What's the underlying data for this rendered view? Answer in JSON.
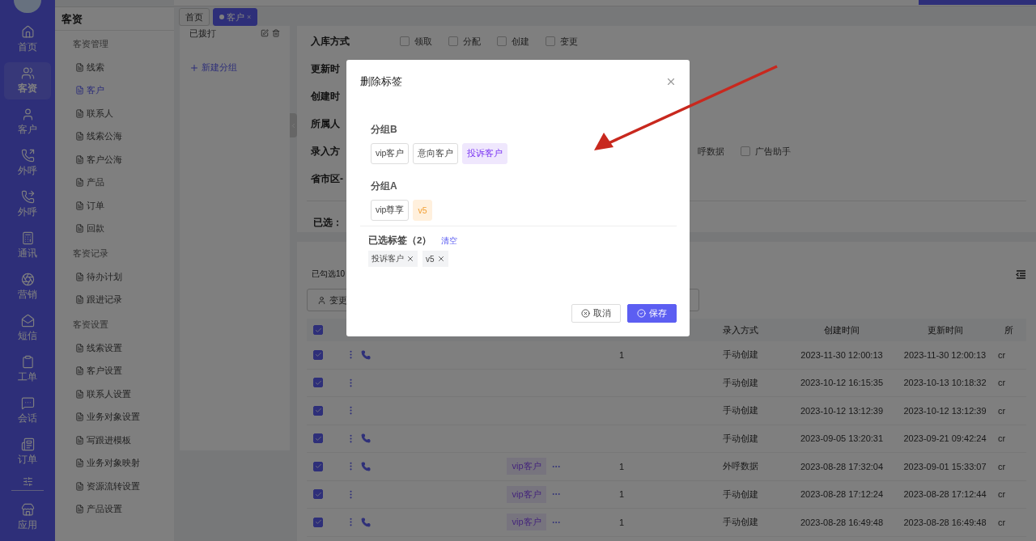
{
  "rail": {
    "items": [
      {
        "kind": "home",
        "label": "首页",
        "selected": false
      },
      {
        "kind": "users",
        "label": "客资",
        "selected": true
      },
      {
        "kind": "user",
        "label": "客户",
        "selected": false
      },
      {
        "kind": "call-out",
        "label": "外呼",
        "selected": false
      },
      {
        "kind": "call-forward",
        "label": "外呼",
        "selected": false
      },
      {
        "kind": "calculator",
        "label": "通讯",
        "selected": false
      },
      {
        "kind": "aperture",
        "label": "营销",
        "selected": false
      },
      {
        "kind": "mail",
        "label": "短信",
        "selected": false
      },
      {
        "kind": "clipboard",
        "label": "工单",
        "selected": false
      },
      {
        "kind": "chat",
        "label": "会话",
        "selected": false
      },
      {
        "kind": "list",
        "label": "订单",
        "selected": false
      },
      {
        "kind": "store",
        "label": "应用",
        "selected": false
      }
    ]
  },
  "sidebar": {
    "title": "客资",
    "sections": [
      {
        "title": "客资管理",
        "items": [
          {
            "label": "线索",
            "selected": false
          },
          {
            "label": "客户",
            "selected": true
          },
          {
            "label": "联系人",
            "selected": false
          },
          {
            "label": "线索公海",
            "selected": false
          },
          {
            "label": "客户公海",
            "selected": false
          },
          {
            "label": "产品",
            "selected": false
          },
          {
            "label": "订单",
            "selected": false
          },
          {
            "label": "回款",
            "selected": false
          }
        ]
      },
      {
        "title": "客资记录",
        "items": [
          {
            "label": "待办计划",
            "selected": false
          },
          {
            "label": "跟进记录",
            "selected": false
          }
        ]
      },
      {
        "title": "客资设置",
        "items": [
          {
            "label": "线索设置",
            "selected": false
          },
          {
            "label": "客户设置",
            "selected": false
          },
          {
            "label": "联系人设置",
            "selected": false
          },
          {
            "label": "业务对象设置",
            "selected": false
          },
          {
            "label": "写跟进模板",
            "selected": false
          },
          {
            "label": "业务对象映射",
            "selected": false
          },
          {
            "label": "资源流转设置",
            "selected": false
          },
          {
            "label": "产品设置",
            "selected": false
          }
        ]
      }
    ]
  },
  "tabs": [
    {
      "label": "首页",
      "selected": false
    },
    {
      "label": "客户",
      "selected": true,
      "close": "×"
    }
  ],
  "groups_panel": {
    "items": [
      {
        "label": "已拨打"
      }
    ],
    "new_group": "新建分组"
  },
  "filters": {
    "rows": [
      {
        "label": "入库方式",
        "kind": "open",
        "options": [
          {
            "label": "领取",
            "checked": false
          },
          {
            "label": "分配",
            "checked": false
          },
          {
            "label": "创建",
            "checked": false
          },
          {
            "label": "变更",
            "checked": false
          }
        ]
      },
      {
        "label": "更新时",
        "kind": "open",
        "options": []
      },
      {
        "label": "创建时",
        "kind": "open",
        "options": []
      },
      {
        "label": "所属人",
        "kind": "open",
        "options": []
      },
      {
        "label": "录入方",
        "kind": "covered",
        "options": [
          {
            "label": "呼数据"
          },
          {
            "label": "广告助手",
            "checked": false
          }
        ]
      },
      {
        "label": "省市区-",
        "kind": "open",
        "options": []
      }
    ],
    "selected_label": "已选："
  },
  "table": {
    "selected_count": "已勾选10",
    "toolbar_button": "变更",
    "all_checked": true,
    "columns": [
      "录入方式",
      "创建时间",
      "更新时间",
      "所"
    ],
    "rows": [
      {
        "checked": true,
        "phone": true,
        "tag": "",
        "number": "1",
        "source": "手动创建",
        "created": "2023-11-30 12:00:13",
        "updated": "2023-11-30 12:00:13",
        "owner": "cr"
      },
      {
        "checked": true,
        "phone": false,
        "tag": "",
        "number": "",
        "source": "手动创建",
        "created": "2023-10-12 16:15:35",
        "updated": "2023-10-13 10:18:32",
        "owner": "cr"
      },
      {
        "checked": true,
        "phone": false,
        "tag": "",
        "number": "",
        "source": "手动创建",
        "created": "2023-10-12 13:12:39",
        "updated": "2023-10-12 13:12:39",
        "owner": "cr"
      },
      {
        "checked": true,
        "phone": true,
        "tag": "",
        "number": "",
        "source": "手动创建",
        "created": "2023-09-05 13:20:31",
        "updated": "2023-09-21 09:42:24",
        "owner": "cr"
      },
      {
        "checked": true,
        "phone": true,
        "tag": "vip客户",
        "number": "1",
        "source": "外呼数据",
        "created": "2023-08-28 17:32:04",
        "updated": "2023-09-01 15:33:07",
        "owner": "cr"
      },
      {
        "checked": true,
        "phone": false,
        "tag": "vip客户",
        "number": "1",
        "source": "手动创建",
        "created": "2023-08-28 17:12:24",
        "updated": "2023-08-28 17:12:44",
        "owner": "cr"
      },
      {
        "checked": true,
        "phone": true,
        "tag": "vip客户",
        "number": "1",
        "source": "手动创建",
        "created": "2023-08-28 16:49:48",
        "updated": "2023-08-28 16:49:48",
        "owner": "cr"
      }
    ]
  },
  "modal": {
    "title": "删除标签",
    "groups": [
      {
        "name": "分组B",
        "tags": [
          {
            "label": "vip客户"
          },
          {
            "label": "意向客户"
          },
          {
            "label": "投诉客户",
            "color": "#efe7fd"
          }
        ]
      },
      {
        "name": "分组A",
        "tags": [
          {
            "label": "vip尊享"
          },
          {
            "label": "v5",
            "color": "#fff0dd"
          }
        ]
      }
    ],
    "chosen_title": "已选标签（2）",
    "clear": "清空",
    "chosen": [
      {
        "label": "投诉客户"
      },
      {
        "label": "v5"
      }
    ],
    "cancel": "取消",
    "save": "保存"
  }
}
